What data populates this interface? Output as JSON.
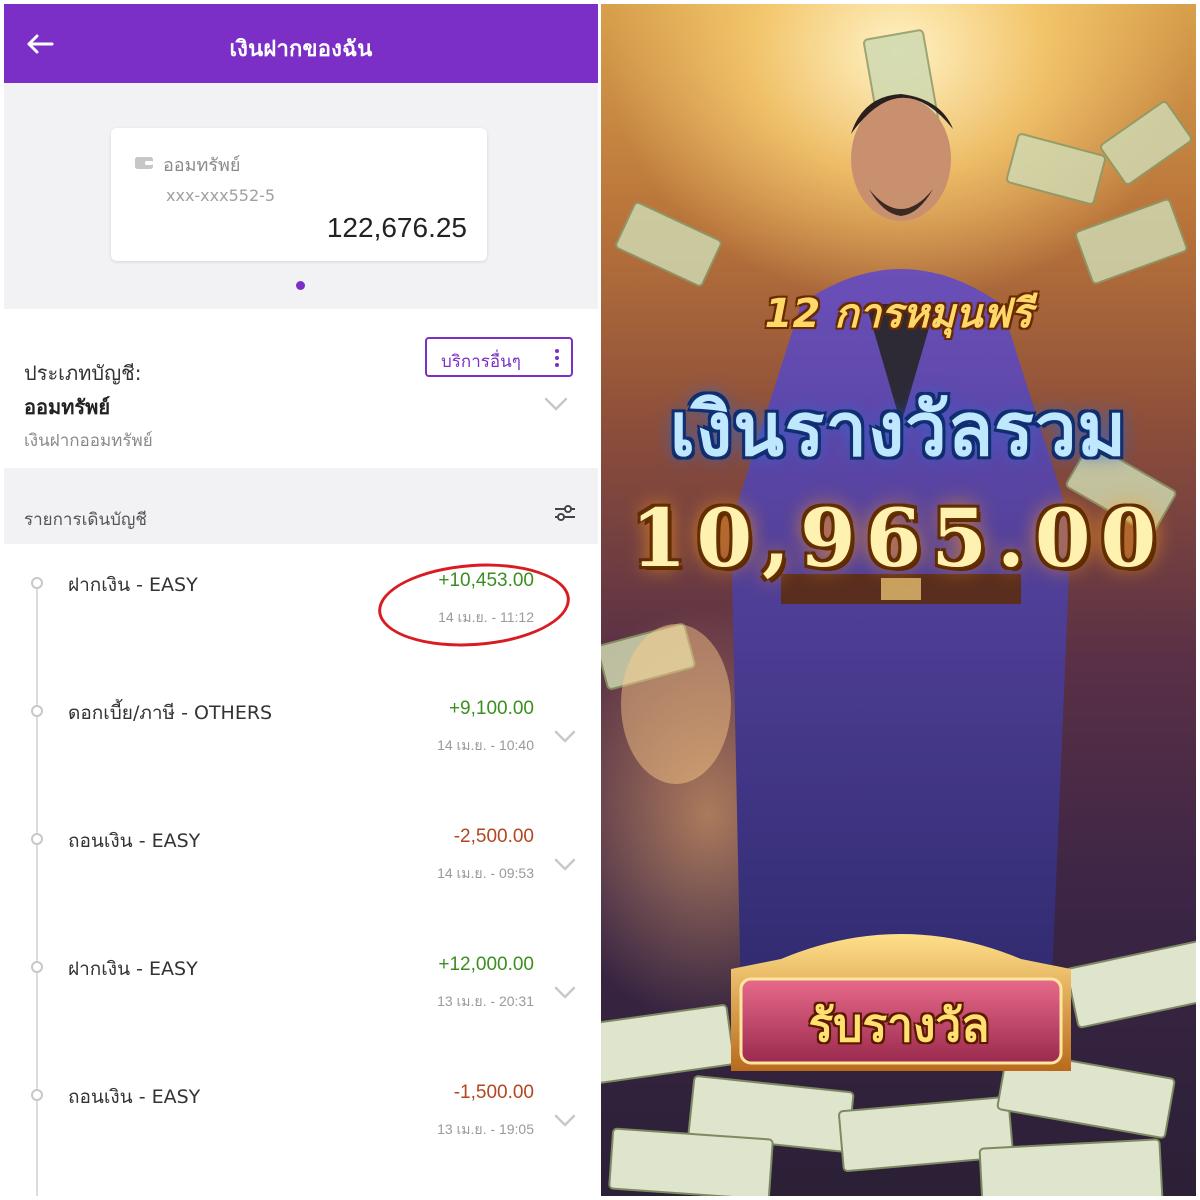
{
  "bank_app": {
    "header": {
      "title": "เงินฝากของฉัน"
    },
    "account_card": {
      "type": "ออมทรัพย์",
      "number": "xxx-xxx552-5",
      "balance": "122,676.25"
    },
    "account_type_section": {
      "label": "ประเภทบัญชี:",
      "value": "ออมทรัพย์",
      "description": "เงินฝากออมทรัพย์",
      "services_button": "บริการอื่นๆ"
    },
    "statement": {
      "title": "รายการเดินบัญชี",
      "transactions": [
        {
          "description": "ฝากเงิน - EASY",
          "amount": "+10,453.00",
          "date": "14 เม.ย. - 11:12",
          "direction": "credit"
        },
        {
          "description": "ดอกเบี้ย/ภาษี - OTHERS",
          "amount": "+9,100.00",
          "date": "14 เม.ย. - 10:40",
          "direction": "credit"
        },
        {
          "description": "ถอนเงิน - EASY",
          "amount": "-2,500.00",
          "date": "14 เม.ย. - 09:53",
          "direction": "debit"
        },
        {
          "description": "ฝากเงิน - EASY",
          "amount": "+12,000.00",
          "date": "13 เม.ย. - 20:31",
          "direction": "credit"
        },
        {
          "description": "ถอนเงิน - EASY",
          "amount": "-1,500.00",
          "date": "13 เม.ย. - 19:05",
          "direction": "debit"
        }
      ]
    },
    "colors": {
      "brand": "#7b2fc6",
      "credit": "#3a8f1f",
      "debit": "#b3461f",
      "highlight": "#d81c22"
    }
  },
  "game_promo": {
    "free_spins_text": "12 การหมุนฟรี",
    "total_prize_title": "เงินรางวัลรวม",
    "prize_amount": "10,965.00",
    "claim_button": "รับรางวัล",
    "colors": {
      "title_text": "#bfe8ff",
      "amount_text": "#fff1b0",
      "button_text": "#ffe070"
    }
  }
}
